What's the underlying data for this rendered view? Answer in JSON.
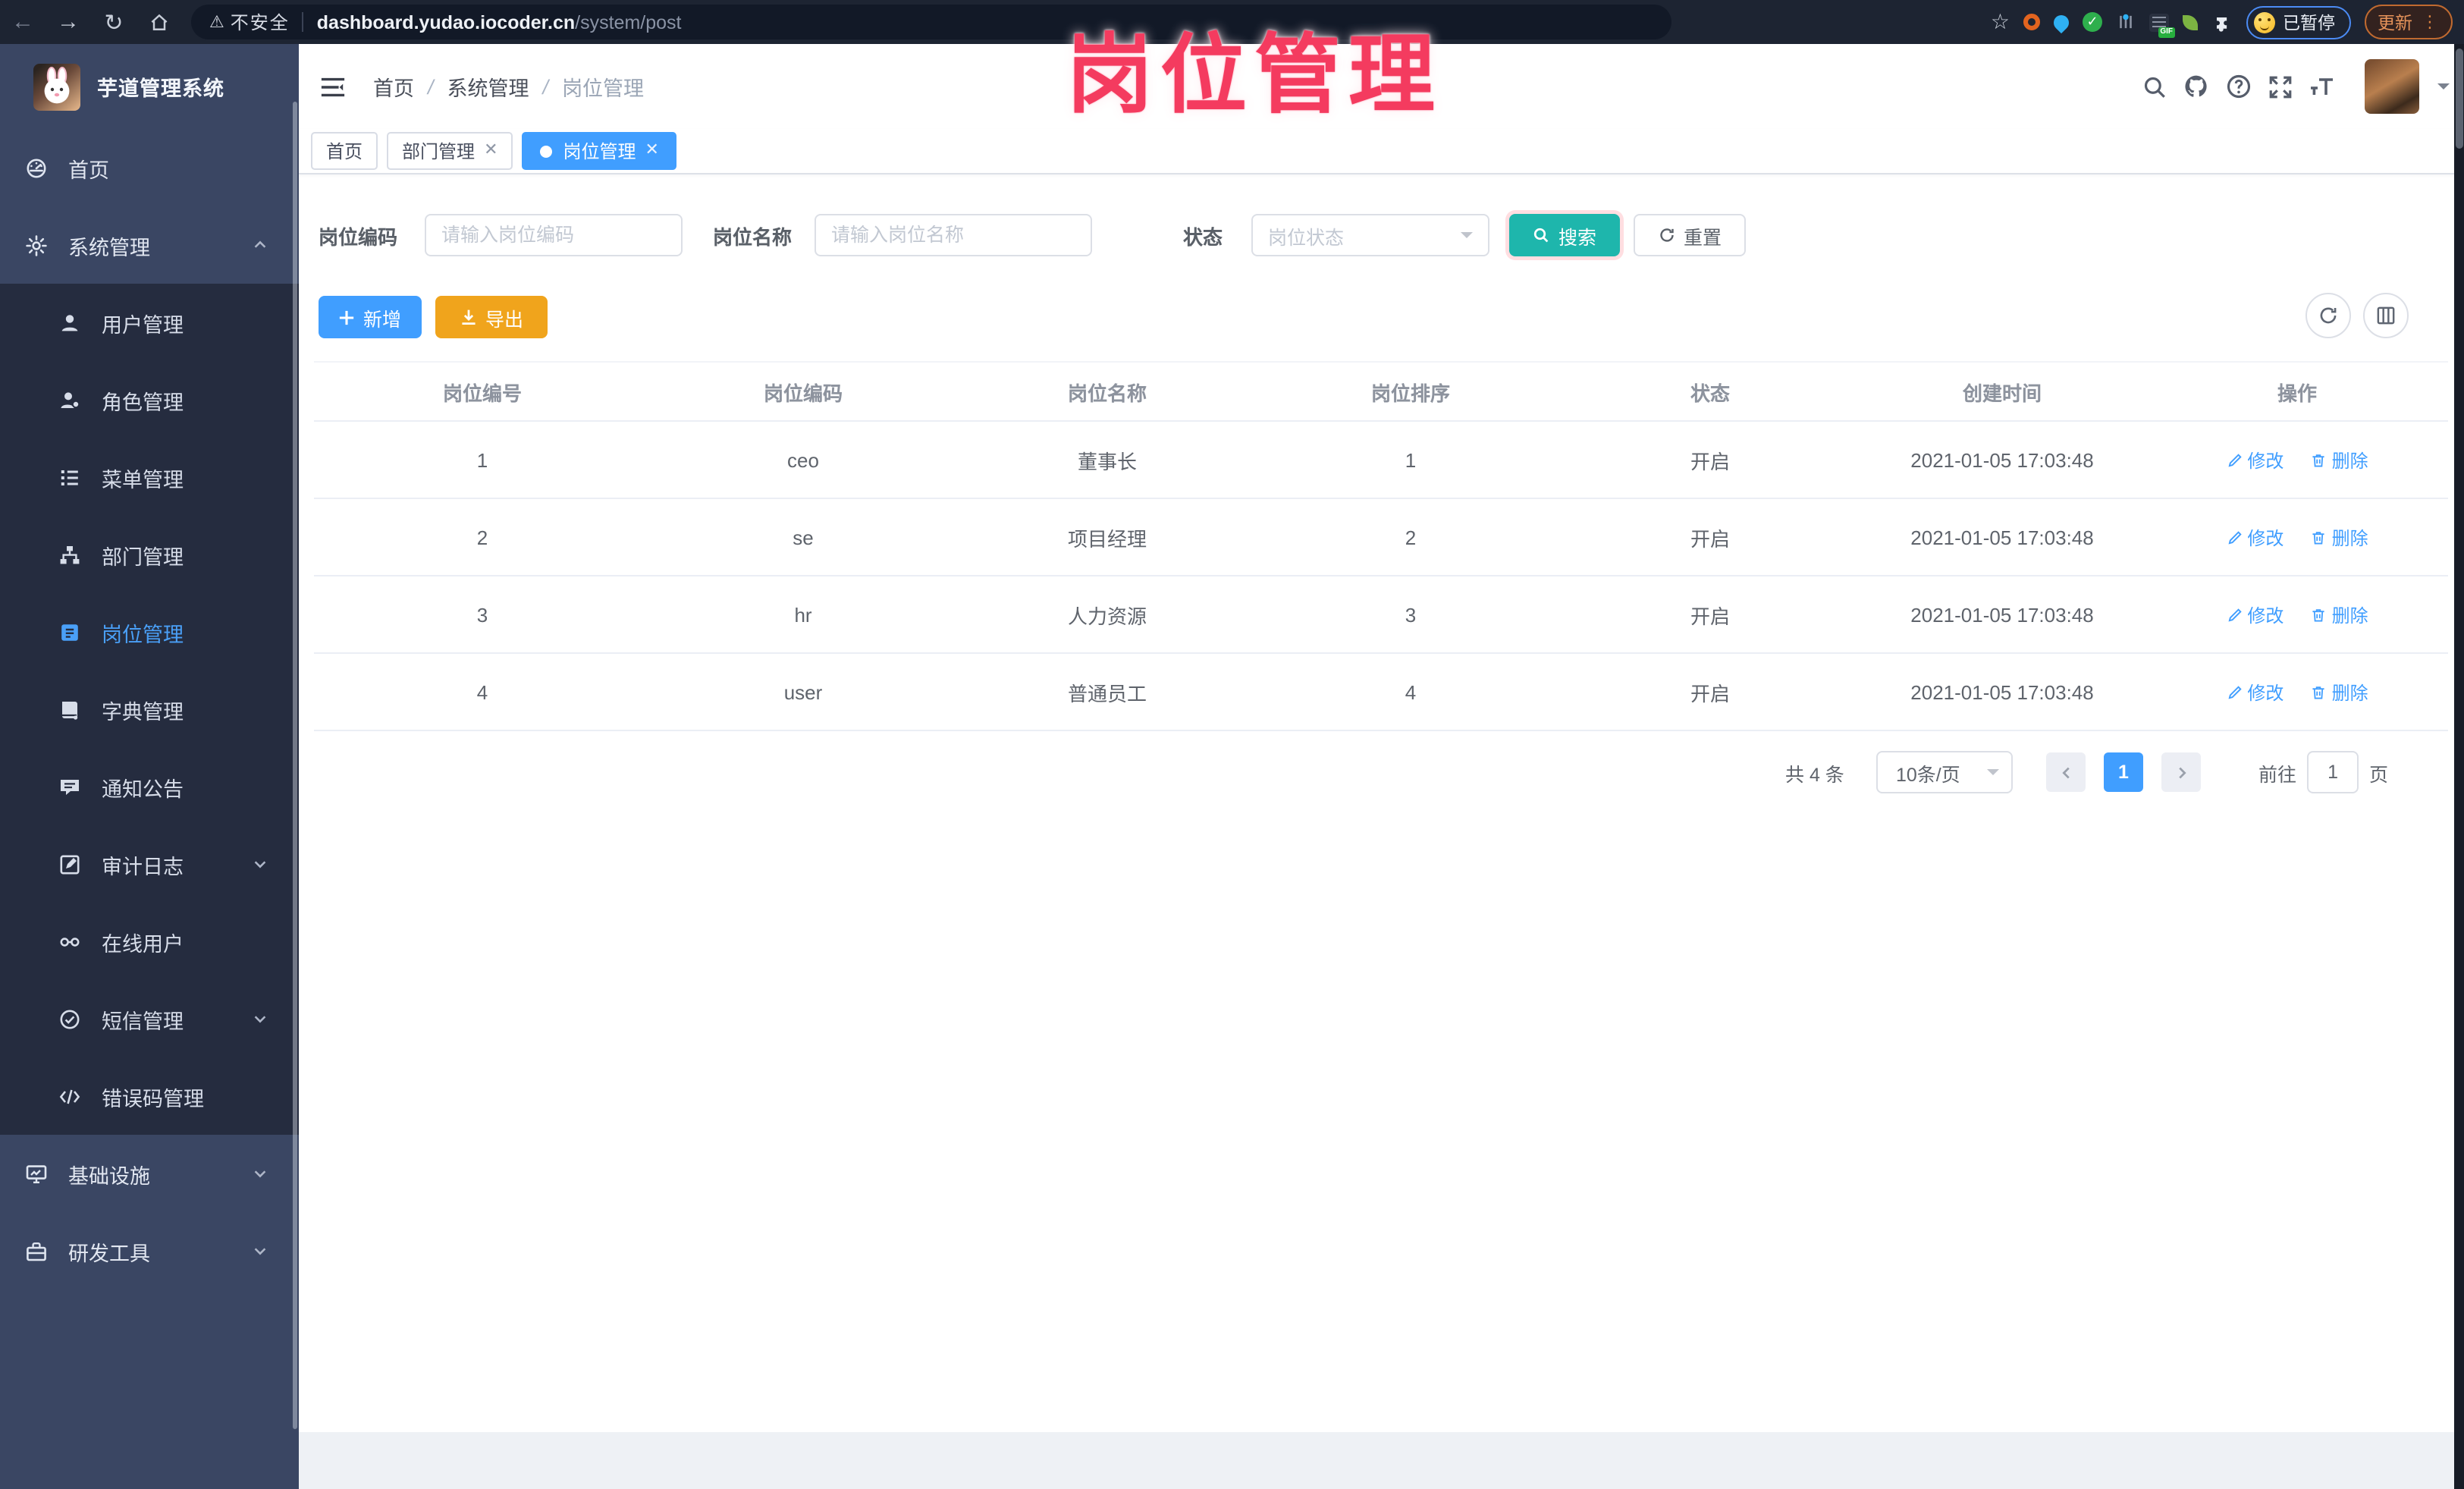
{
  "annotation": {
    "text": "岗位管理"
  },
  "browser": {
    "security": "不安全",
    "url_domain": "dashboard.yudao.iocoder.cn",
    "url_path": "/system/post",
    "ext_badge": "GIF",
    "paused": "已暂停",
    "update": "更新"
  },
  "sidebar": {
    "title": "芋道管理系统",
    "items": [
      {
        "label": "首页"
      },
      {
        "label": "系统管理"
      },
      {
        "label": "用户管理"
      },
      {
        "label": "角色管理"
      },
      {
        "label": "菜单管理"
      },
      {
        "label": "部门管理"
      },
      {
        "label": "岗位管理"
      },
      {
        "label": "字典管理"
      },
      {
        "label": "通知公告"
      },
      {
        "label": "审计日志"
      },
      {
        "label": "在线用户"
      },
      {
        "label": "短信管理"
      },
      {
        "label": "错误码管理"
      },
      {
        "label": "基础设施"
      },
      {
        "label": "研发工具"
      }
    ]
  },
  "header": {
    "breadcrumb": [
      "首页",
      "系统管理",
      "岗位管理"
    ]
  },
  "tabs": [
    {
      "label": "首页"
    },
    {
      "label": "部门管理"
    },
    {
      "label": "岗位管理"
    }
  ],
  "filters": {
    "code_label": "岗位编码",
    "code_placeholder": "请输入岗位编码",
    "name_label": "岗位名称",
    "name_placeholder": "请输入岗位名称",
    "status_label": "状态",
    "status_placeholder": "岗位状态",
    "search": "搜索",
    "reset": "重置"
  },
  "actions": {
    "add": "新增",
    "export": "导出"
  },
  "table": {
    "headers": [
      "岗位编号",
      "岗位编码",
      "岗位名称",
      "岗位排序",
      "状态",
      "创建时间",
      "操作"
    ],
    "edit": "修改",
    "delete": "删除",
    "rows": [
      {
        "id": "1",
        "code": "ceo",
        "name": "董事长",
        "sort": "1",
        "status": "开启",
        "created": "2021-01-05 17:03:48"
      },
      {
        "id": "2",
        "code": "se",
        "name": "项目经理",
        "sort": "2",
        "status": "开启",
        "created": "2021-01-05 17:03:48"
      },
      {
        "id": "3",
        "code": "hr",
        "name": "人力资源",
        "sort": "3",
        "status": "开启",
        "created": "2021-01-05 17:03:48"
      },
      {
        "id": "4",
        "code": "user",
        "name": "普通员工",
        "sort": "4",
        "status": "开启",
        "created": "2021-01-05 17:03:48"
      }
    ]
  },
  "pagination": {
    "total": "共 4 条",
    "size": "10条/页",
    "page": "1",
    "goto": "前往",
    "goto_value": "1",
    "unit": "页"
  },
  "colors": {
    "primary": "#409EFF",
    "success": "#1EB6AC",
    "warning": "#F0A41C",
    "annotation": "#F43B5F"
  }
}
